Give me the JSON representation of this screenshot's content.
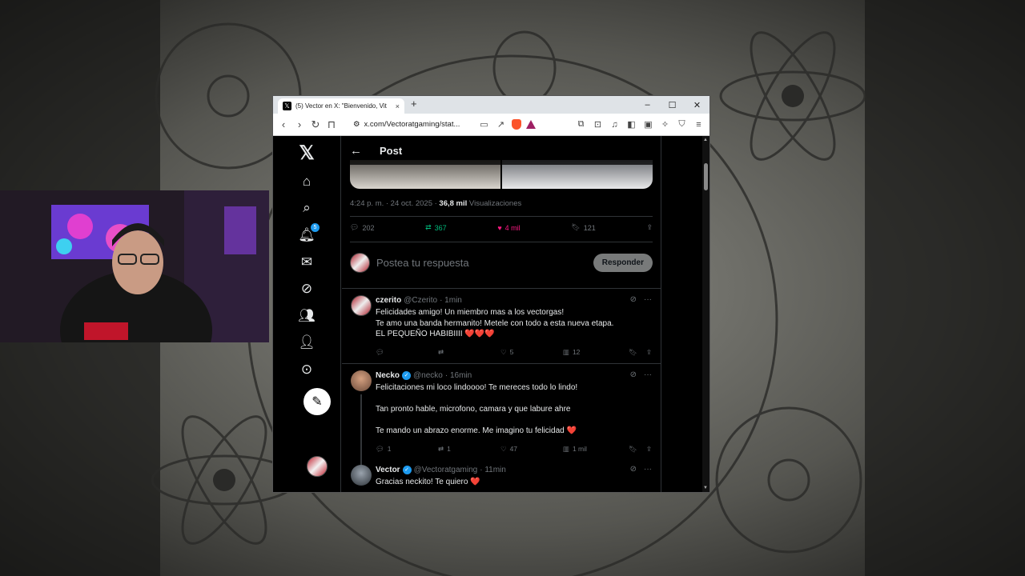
{
  "browser": {
    "tab_title": "(5) Vector en X: \"Bienvenido, Vit",
    "tab_close": "×",
    "new_tab": "+",
    "url": "x.com/Vectoratgaming/stat...",
    "window_controls": [
      "–",
      "☐",
      "✕"
    ]
  },
  "nav": {
    "notifications_badge": "5",
    "icons": [
      "x-logo",
      "home-icon",
      "search-icon",
      "notifications-icon",
      "messages-icon",
      "grok-icon",
      "communities-icon",
      "profile-icon",
      "more-icon"
    ]
  },
  "post": {
    "header_title": "Post",
    "timestamp": "4:24 p. m. · 24 oct. 2025 · ",
    "views_count": "36,8 mil",
    "views_label": " Visualizaciones",
    "replies": "202",
    "reposts": "367",
    "likes": "4 mil",
    "bookmarks": "121"
  },
  "reply_box": {
    "placeholder": "Postea tu respuesta",
    "button": "Responder"
  },
  "replies": [
    {
      "name": "czerito",
      "handle": "@Czerito",
      "time": "· 1min",
      "text": "Felicidades amigo! Un miembro mas a los vectorgas!\nTe amo una banda hermanito! Metele con todo a esta nueva etapa.\nEL PEQUEÑO HABIBIIII ❤️❤️❤️",
      "replies": "",
      "reposts": "",
      "likes": "5",
      "views": "12",
      "verified": false
    },
    {
      "name": "Necko",
      "handle": "@necko",
      "time": "· 16min",
      "text": "Felicitaciones mi loco lindoooo! Te mereces todo lo lindo!\n\nTan pronto hable, microfono, camara y que labure ahre\n\nTe mando un abrazo enorme. Me imagino tu felicidad ❤️",
      "replies": "1",
      "reposts": "1",
      "likes": "47",
      "views": "1 mil",
      "verified": true
    },
    {
      "name": "Vector",
      "handle": "@Vectoratgaming",
      "time": "· 11min",
      "text": "Gracias neckito! Te quiero ❤️",
      "verified": true
    }
  ],
  "colors": {
    "accent": "#1d9bf0",
    "like": "#f91880",
    "repost": "#00ba7c"
  }
}
